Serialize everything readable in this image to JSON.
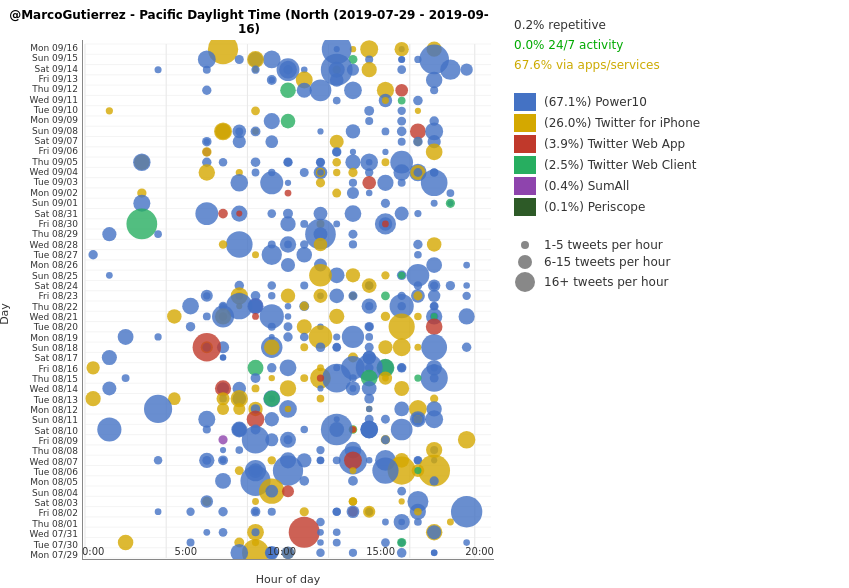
{
  "title": "@MarcoGutierrez - Pacific Daylight Time (North  (2019-07-29 - 2019-09-16)",
  "chart": {
    "x_axis_label": "Hour of day",
    "y_axis_label": "Day",
    "x_ticks": [
      "0:00",
      "5:00",
      "10:00",
      "15:00",
      "20:00"
    ],
    "y_labels": [
      "Mon 09/16",
      "Sun 09/15",
      "Sat 09/14",
      "Fri 09/13",
      "Thu 09/12",
      "Wed 09/11",
      "Tue 09/10",
      "Mon 09/09",
      "Sun 09/08",
      "Sat 09/07",
      "Fri 09/06",
      "Thu 09/05",
      "Wed 09/04",
      "Tue 09/03",
      "Mon 09/02",
      "Sun 09/01",
      "Sat 08/31",
      "Fri 08/30",
      "Thu 08/29",
      "Wed 08/28",
      "Tue 08/27",
      "Mon 08/26",
      "Sun 08/25",
      "Sat 08/24",
      "Fri 08/23",
      "Thu 08/22",
      "Wed 08/21",
      "Tue 08/20",
      "Mon 08/19",
      "Sun 08/18",
      "Sat 08/17",
      "Fri 08/16",
      "Thu 08/15",
      "Wed 08/14",
      "Tue 08/13",
      "Mon 08/12",
      "Sun 08/11",
      "Sat 08/10",
      "Fri 08/09",
      "Thu 08/08",
      "Wed 08/07",
      "Tue 08/06",
      "Mon 08/05",
      "Sun 08/04",
      "Sat 08/03",
      "Fri 08/02",
      "Thu 08/01",
      "Wed 07/31",
      "Tue 07/30",
      "Mon 07/29"
    ]
  },
  "legend": {
    "stat1": {
      "label": "0.2% repetitive",
      "color": "#333"
    },
    "stat2": {
      "label": "0.0% 24/7 activity",
      "color": "#00aa00"
    },
    "stat3": {
      "label": "67.6% via apps/services",
      "color": "#ccaa00"
    },
    "items": [
      {
        "label": "(67.1%) Power10",
        "color": "#4472C4",
        "type": "box"
      },
      {
        "label": "(26.0%) Twitter for iPhone",
        "color": "#d4a800",
        "type": "box"
      },
      {
        "label": "(3.9%) Twitter Web App",
        "color": "#c0392b",
        "type": "box"
      },
      {
        "label": "(2.5%) Twitter Web Client",
        "color": "#27ae60",
        "type": "box"
      },
      {
        "label": "(0.4%) SumAll",
        "color": "#8e44ad",
        "type": "box"
      },
      {
        "label": "(0.1%) Periscope",
        "color": "#2d5a27",
        "type": "box"
      }
    ],
    "size_items": [
      {
        "label": "1-5 tweets per hour",
        "size": 8
      },
      {
        "label": "6-15 tweets per hour",
        "size": 14
      },
      {
        "label": "16+ tweets per hour",
        "size": 20
      }
    ]
  }
}
